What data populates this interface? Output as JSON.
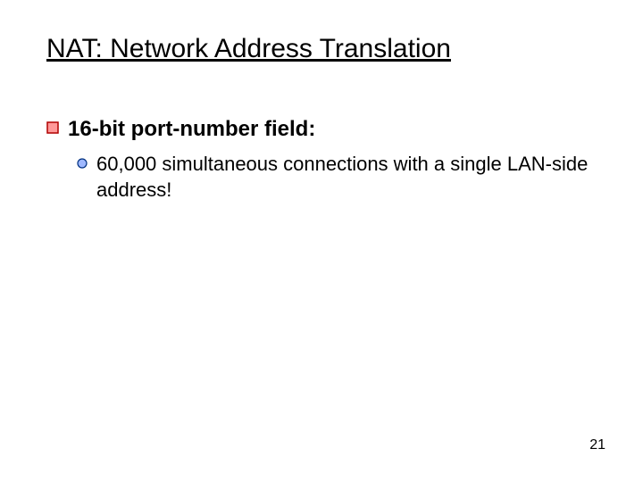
{
  "title": "NAT: Network Address Translation",
  "bullets": {
    "level1": {
      "text": "16-bit port-number field:"
    },
    "level2": {
      "text": "60,000 simultaneous connections with a single LAN-side address!"
    }
  },
  "colors": {
    "squareBorder": "#b00000",
    "squareFill": "#ff9999",
    "circleBorder": "#003080",
    "circleFill": "#9fb8ff"
  },
  "page_number": "21"
}
